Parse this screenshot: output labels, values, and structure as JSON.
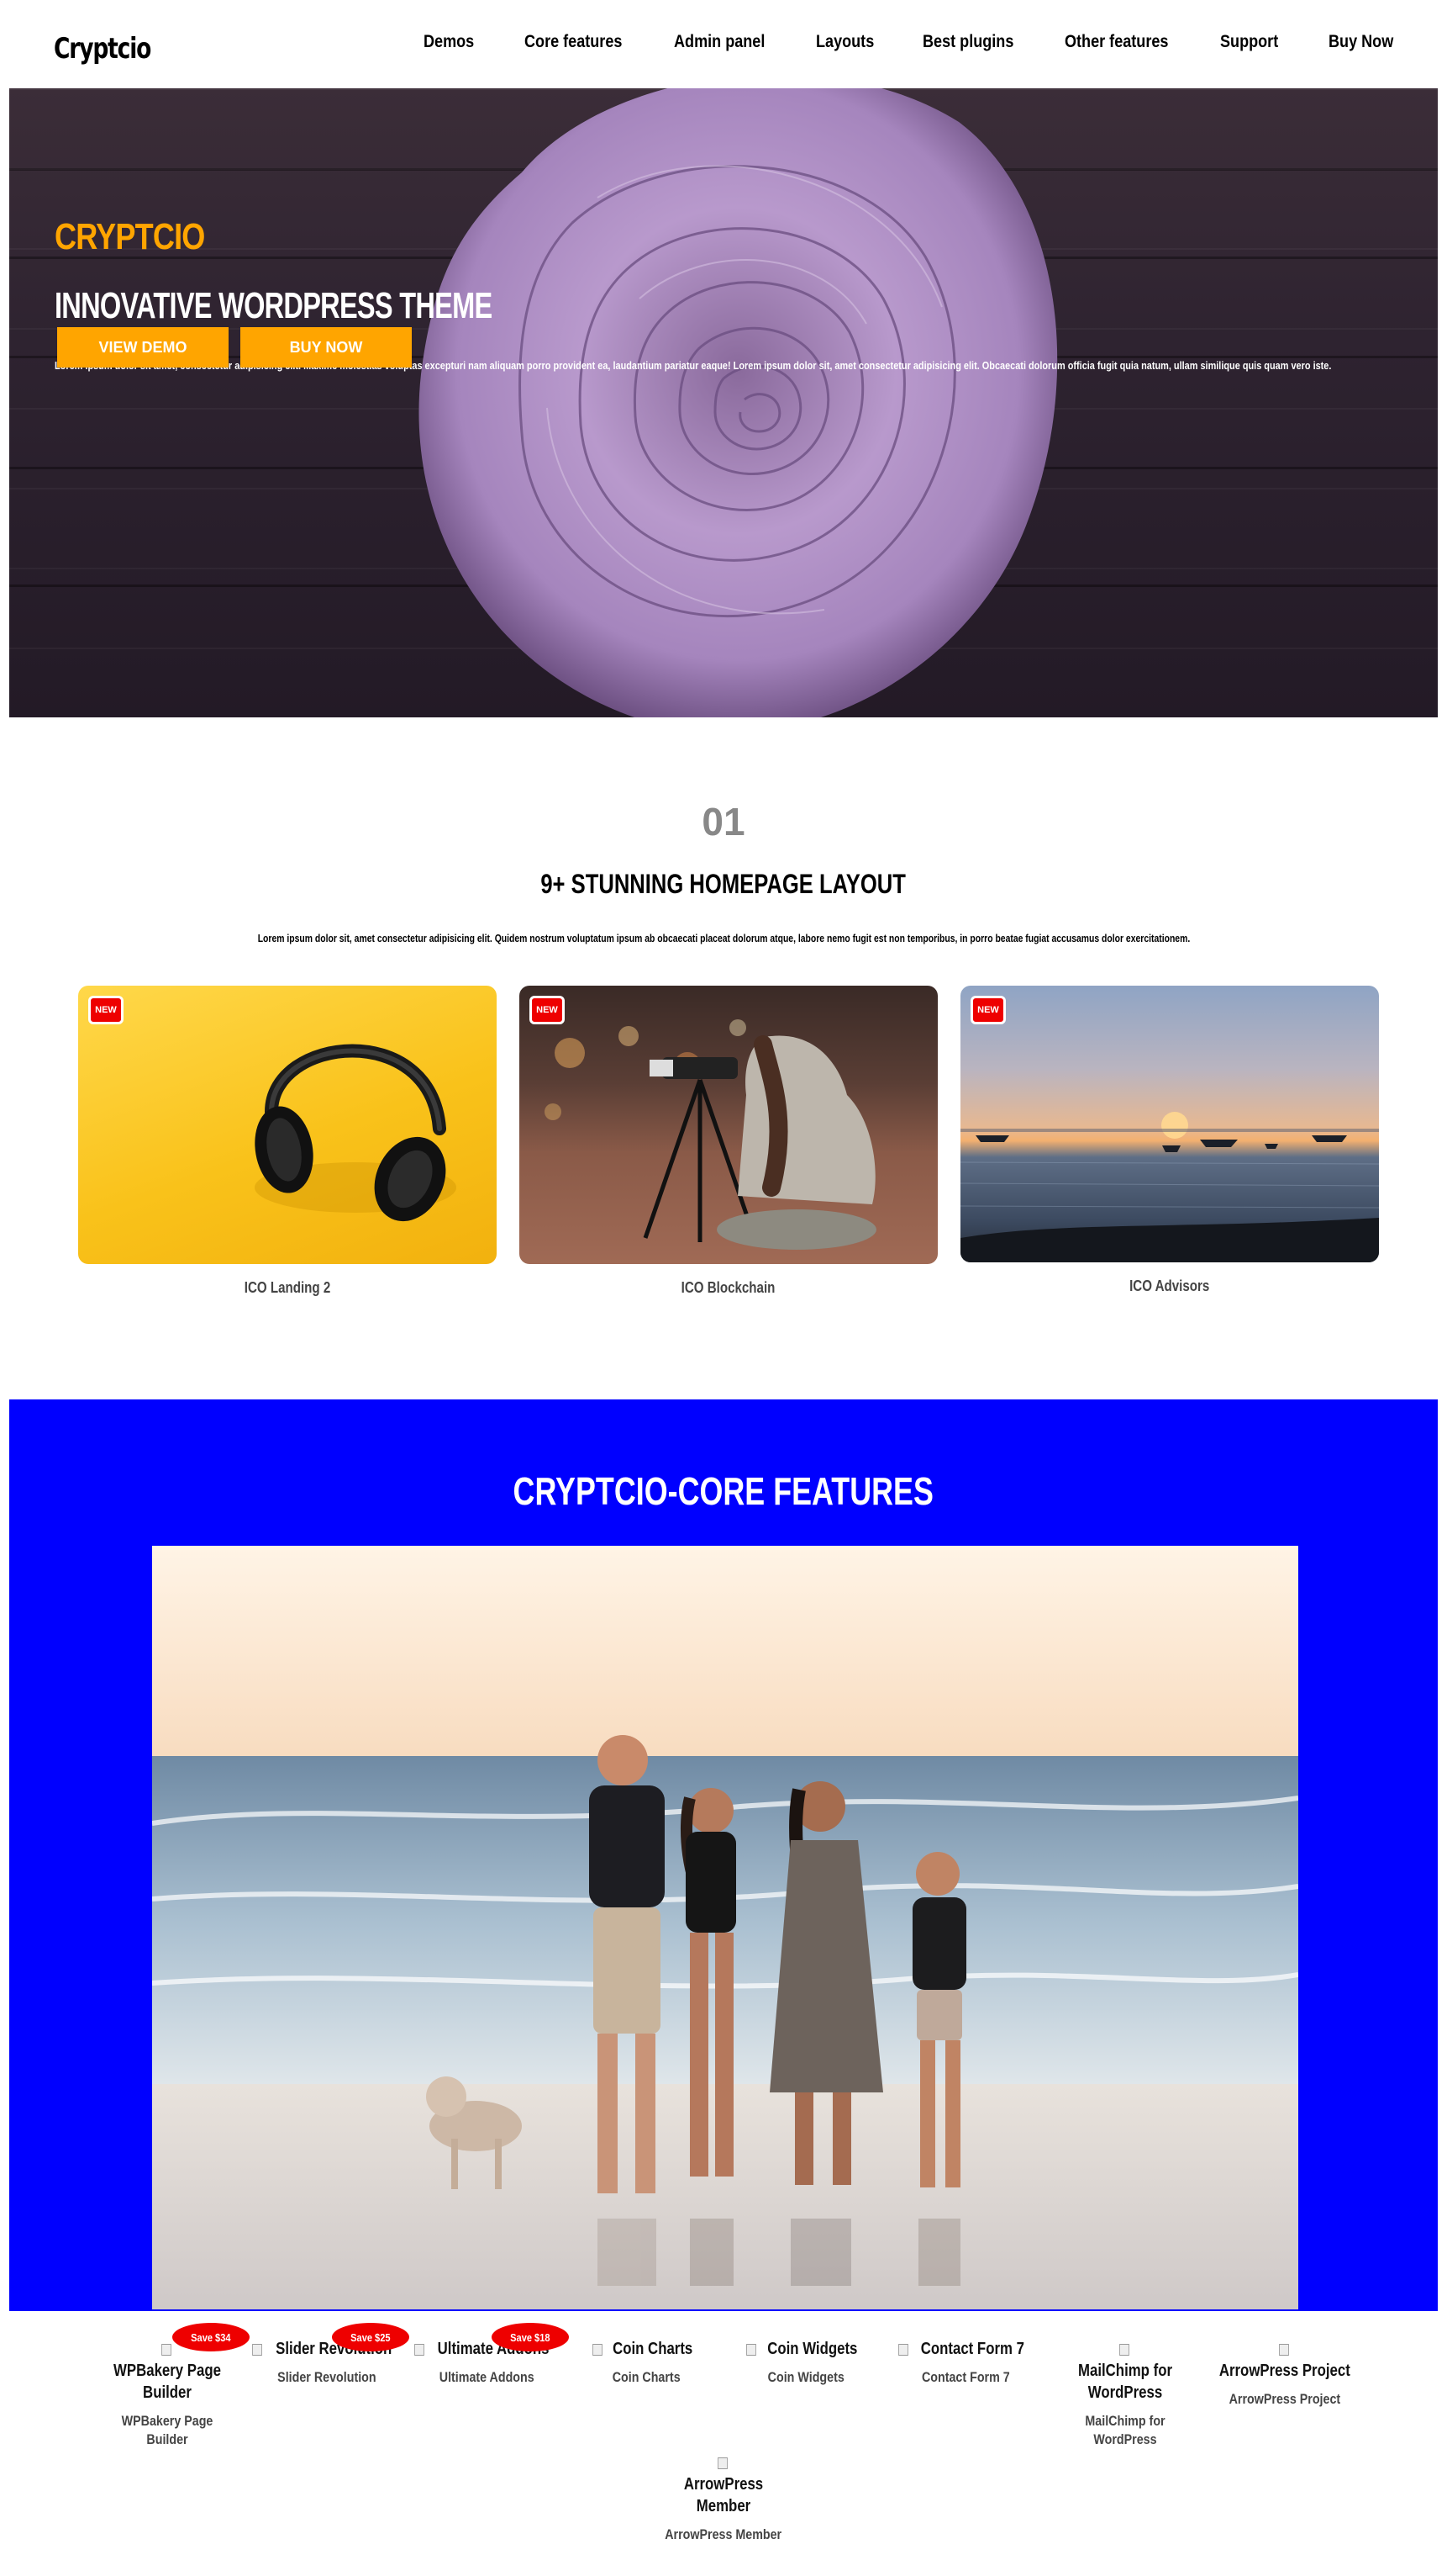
{
  "header": {
    "logo": "Cryptcio",
    "nav": [
      "Demos",
      "Core features",
      "Admin panel",
      "Layouts",
      "Best plugins",
      "Other features",
      "Support",
      "Buy Now"
    ]
  },
  "hero": {
    "brand": "CRYPTCIO",
    "title": "INNOVATIVE WORDPRESS THEME",
    "description": "Lorem ipsum dolor sit amet, consectetur adipisicing elit. Maxime molestias voluptas excepturi nam aliquam porro provident ea, laudantium pariatur eaque! Lorem ipsum dolor sit, amet consectetur adipisicing elit. Obcaecati dolorum officia fugit quia natum, ullam similique quis quam vero iste.",
    "btn_demo": "VIEW DEMO",
    "btn_buy": "BUY NOW"
  },
  "layouts": {
    "number": "01",
    "title": "9+ STUNNING HOMEPAGE LAYOUT",
    "subtitle": "Lorem ipsum dolor sit, amet consectetur adipisicing elit. Quidem nostrum voluptatum ipsum ab obcaecati placeat dolorum atque, labore nemo fugit est non temporibus, in porro beatae fugiat accusamus dolor exercitationem.",
    "cards": [
      {
        "badge": "NEW",
        "label": "ICO Landing 2"
      },
      {
        "badge": "NEW",
        "label": "ICO Blockchain"
      },
      {
        "badge": "NEW",
        "label": "ICO Advisors"
      }
    ]
  },
  "core": {
    "title": "CRYPTCIO-CORE FEATURES"
  },
  "plugins": [
    {
      "img_alt": "WPBakery Page Builder",
      "name": "WPBakery Page Builder",
      "save": "Save $34"
    },
    {
      "img_alt": "Slider Revolution",
      "name": "Slider Revolution",
      "save": "Save $25"
    },
    {
      "img_alt": "Ultimate Addons",
      "name": "Ultimate Addons",
      "save": "Save $18"
    },
    {
      "img_alt": "Coin Charts",
      "name": "Coin Charts"
    },
    {
      "img_alt": "Coin Widgets",
      "name": "Coin Widgets"
    },
    {
      "img_alt": "Contact Form 7",
      "name": "Contact Form 7"
    },
    {
      "img_alt": "MailChimp for WordPress",
      "name": "MailChimp for WordPress"
    },
    {
      "img_alt": "ArrowPress Project",
      "name": "ArrowPress Project"
    },
    {
      "img_alt": "ArrowPress Member",
      "name": "ArrowPress Member"
    }
  ],
  "colors": {
    "accent": "#ffa500",
    "core_bg": "#0000ff",
    "badge": "#ee0000"
  }
}
